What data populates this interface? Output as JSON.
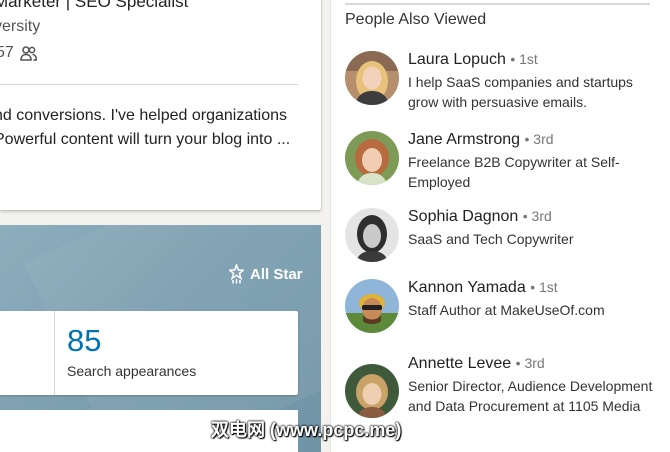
{
  "profile": {
    "headline": "Marketer | SEO Specialist",
    "school": "versity",
    "connections_count": "57",
    "summary_line1": "nd conversions. I've helped organizations",
    "summary_line2": "Powerful content will turn your blog into ..."
  },
  "dashboard": {
    "all_star_label": "All Star",
    "stat_number": "85",
    "stat_label": "Search appearances"
  },
  "people_also_viewed": {
    "title": "People Also Viewed",
    "people": [
      {
        "name": "Laura Lopuch",
        "degree": "• 1st",
        "title": "I help SaaS companies and startups grow with persuasive emails."
      },
      {
        "name": "Jane Armstrong",
        "degree": "• 3rd",
        "title": "Freelance B2B Copywriter at Self-Employed"
      },
      {
        "name": "Sophia Dagnon",
        "degree": "• 3rd",
        "title": "SaaS and Tech Copywriter"
      },
      {
        "name": "Kannon Yamada",
        "degree": "• 1st",
        "title": "Staff Author at MakeUseOf.com"
      },
      {
        "name": "Annette Levee",
        "degree": "• 3rd",
        "title": "Senior Director, Audience Development and Data Procurement at 1105 Media"
      }
    ]
  },
  "watermark": "双电网 (www.pcpc.me)",
  "colors": {
    "accent": "#0073b1",
    "dashboard_bg": "#7c9fb0",
    "page_bg": "#f3f2ef"
  }
}
